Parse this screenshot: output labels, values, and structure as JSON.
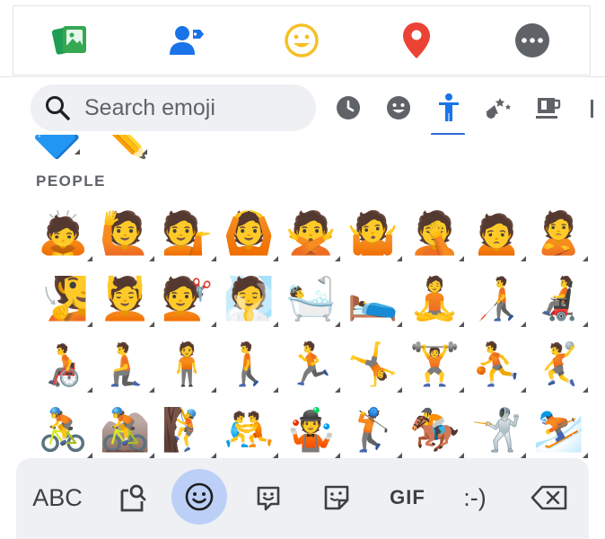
{
  "app_bar": {
    "icons": [
      "photos-icon",
      "contacts-icon",
      "emoji-icon",
      "location-icon",
      "more-icon"
    ]
  },
  "search": {
    "placeholder": "Search emoji"
  },
  "categories": {
    "icons": [
      "recent-icon",
      "smileys-icon",
      "people-icon",
      "activities-icon",
      "objects-icon"
    ],
    "selected": "people-icon",
    "accent": "#2b6bd1"
  },
  "emoji_section": {
    "label": "PEOPLE",
    "rows": [
      [
        "🙇",
        "🙋",
        "💁",
        "🙆",
        "🙅",
        "🤷",
        "🤦",
        "🙍",
        "🙎"
      ],
      [
        "🧏",
        "💆",
        "💇",
        "🧖",
        "🛀",
        "🛌",
        "🧘",
        "🧑‍🦯",
        "🧑‍🦼"
      ],
      [
        "🧑‍🦽",
        "🧎",
        "🧍",
        "🚶",
        "🏃",
        "🤸",
        "🏋️",
        "⛹️",
        "🤾"
      ],
      [
        "🚴",
        "🚵",
        "🧗",
        "🤼",
        "🤹",
        "🏌️",
        "🏇",
        "🤺",
        "⛷️"
      ]
    ],
    "partial_row": [
      "🔷",
      "✏️"
    ]
  },
  "keyboard_bar": {
    "abc_label": "ABC",
    "gif_label": "GIF",
    "emoticon_label": ":-)",
    "active_color": "#bcd0f7"
  }
}
